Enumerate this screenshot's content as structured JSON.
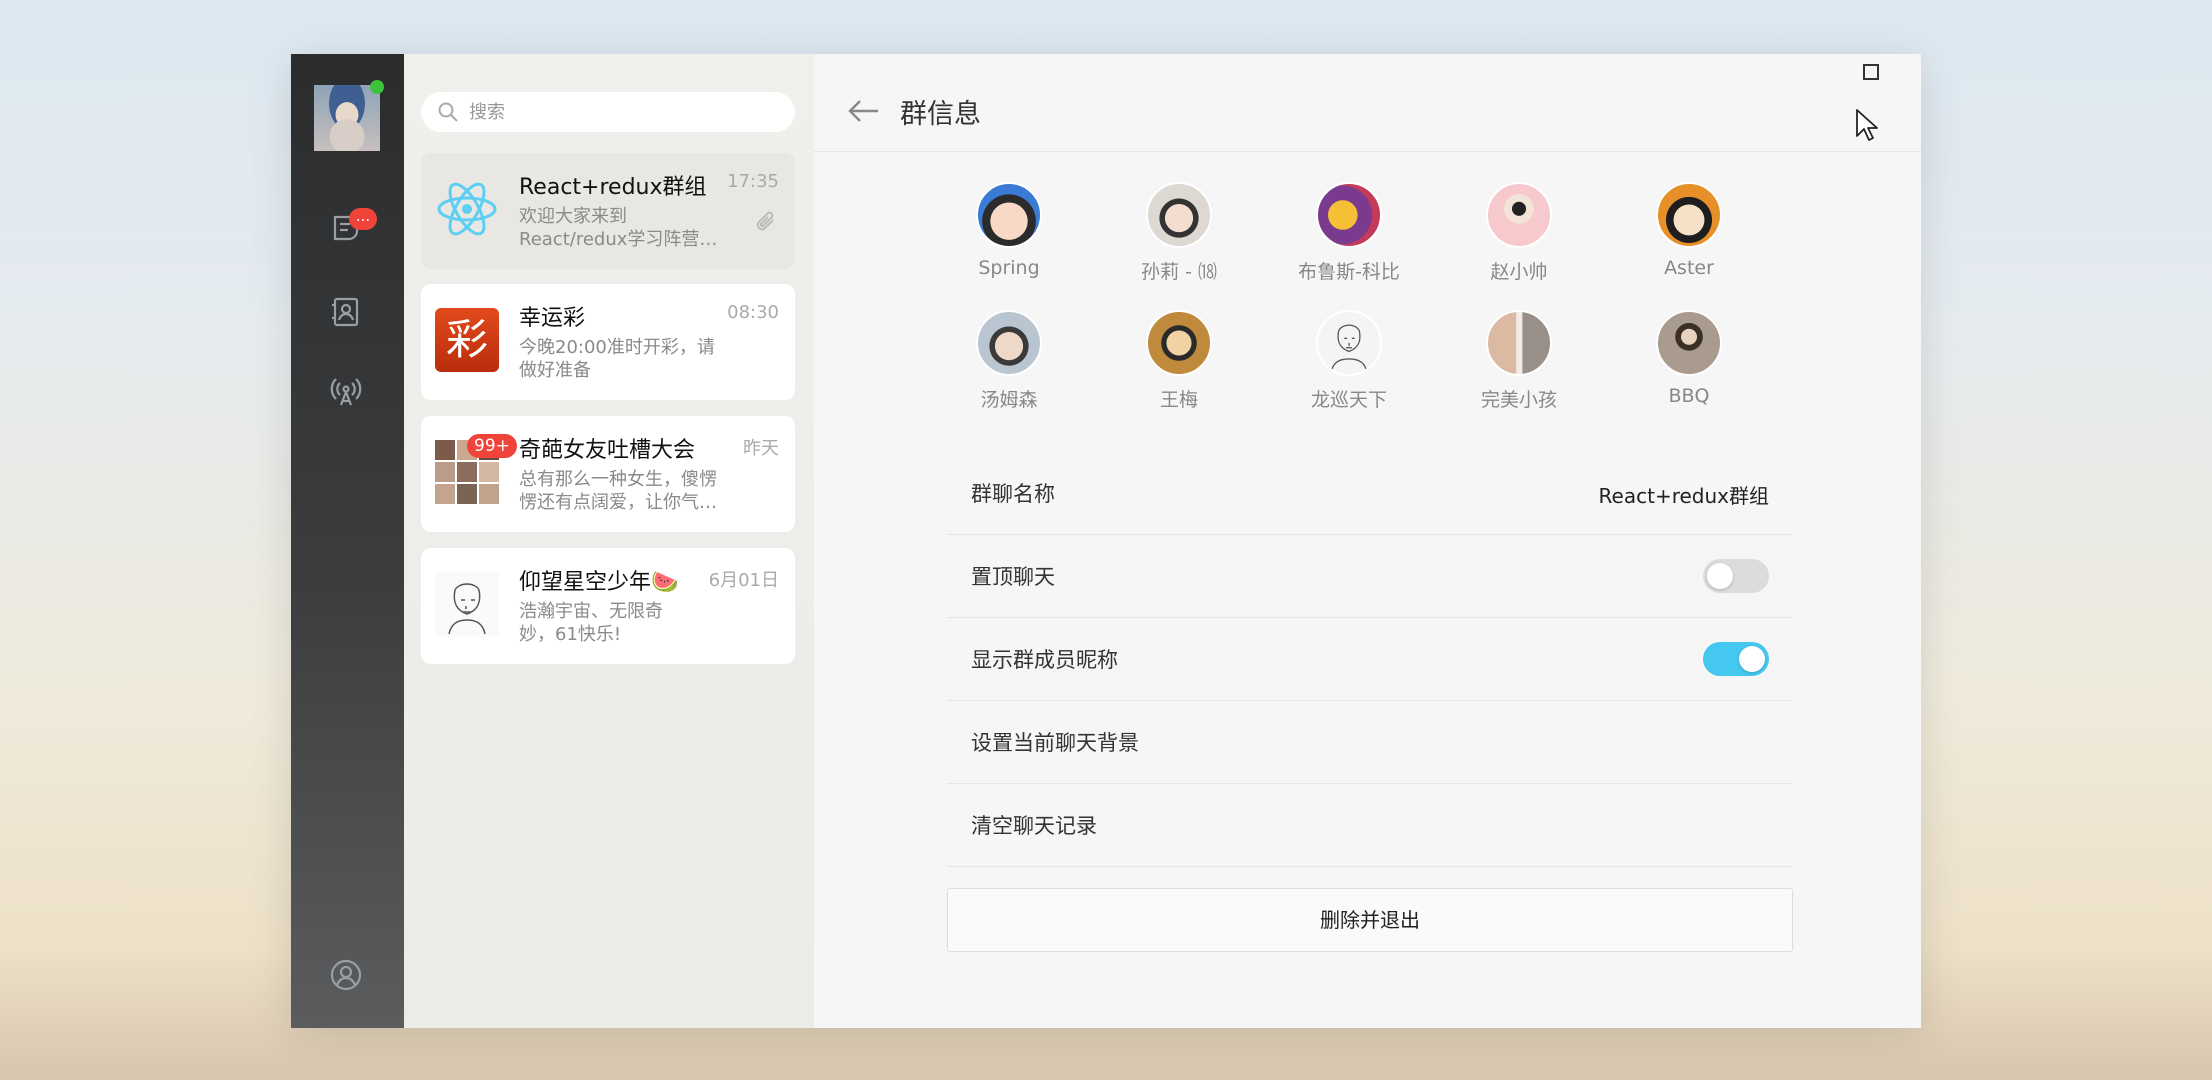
{
  "sidebar": {
    "self_avatar": "user-avatar",
    "chat_badge": "...",
    "icons": [
      "chat-icon",
      "contacts-icon",
      "broadcast-icon",
      "profile-icon"
    ]
  },
  "search": {
    "placeholder": "搜索"
  },
  "chats": [
    {
      "name": "React+redux群组",
      "time": "17:35",
      "preview": "欢迎大家来到React/redux学习阵营…",
      "icon": "react-logo-icon",
      "attachment": true
    },
    {
      "name": "幸运彩",
      "time": "08:30",
      "preview": "今晚20:00准时开彩，请做好准备",
      "icon": "lottery-logo-icon",
      "thumb_text": "彩"
    },
    {
      "name": "奇葩女友吐槽大会",
      "time": "昨天",
      "preview": "总有那么一种女生，傻愣愣还有点阔爱，让你气…",
      "badge": "99+",
      "icon": "group-collage-avatar"
    },
    {
      "name": "仰望星空少年🍉",
      "time": "6月01日",
      "preview": "浩瀚宇宙、无限奇妙，61快乐!",
      "icon": "sketch-portrait-avatar"
    }
  ],
  "detail": {
    "title": "群信息",
    "members": [
      {
        "name": "Spring",
        "color": "#f4c3a8"
      },
      {
        "name": "孙莉 - ⒅",
        "color": "#d9d2c8"
      },
      {
        "name": "布鲁斯-科比",
        "color": "#7a3b8f"
      },
      {
        "name": "赵小帅",
        "color": "#f7c9cd"
      },
      {
        "name": "Aster",
        "color": "#e7902a"
      },
      {
        "name": "汤姆森",
        "color": "#b9c6d2"
      },
      {
        "name": "王梅",
        "color": "#c08a3c"
      },
      {
        "name": "龙巡天下",
        "color": "#f2f2f2"
      },
      {
        "name": "完美小孩",
        "color": "#bcc5d1"
      },
      {
        "name": "BBQ",
        "color": "#a99b8d"
      }
    ],
    "settings": {
      "group_name_label": "群聊名称",
      "group_name_value": "React+redux群组",
      "pin_label": "置顶聊天",
      "pin_on": false,
      "show_nickname_label": "显示群成员昵称",
      "show_nickname_on": true,
      "background_label": "设置当前聊天背景",
      "clear_label": "清空聊天记录"
    },
    "delete_button": "删除并退出"
  },
  "colors": {
    "accent": "#45c8ef",
    "badge": "#f0443a",
    "online": "#3cc33c"
  }
}
